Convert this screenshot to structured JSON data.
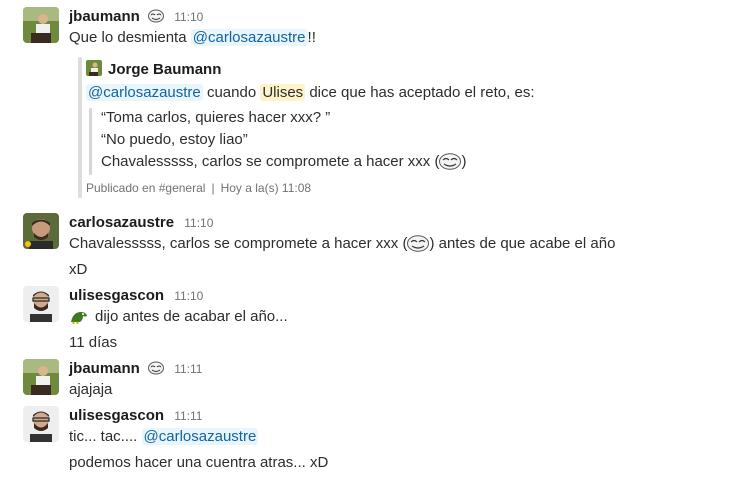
{
  "messages": [
    {
      "user": "jbaumann",
      "time": "11:10",
      "text_before": "Que lo desmienta ",
      "mention": "@carlosazaustre",
      "text_after": "!!"
    },
    {
      "user": "carlosazaustre",
      "time": "11:10",
      "line1": "Chavalesssss, carlos se compromete a hacer xxx (",
      "line1_after": ") antes de que acabe el año",
      "line2": "xD"
    },
    {
      "user": "ulisesgascon",
      "time": "11:10",
      "line1": "dijo antes de acabar el año...",
      "line2": "11 días"
    },
    {
      "user": "jbaumann",
      "time": "11:11",
      "line1": "ajajaja"
    },
    {
      "user": "ulisesgascon",
      "time": "11:11",
      "line1_before": "tic... tac.... ",
      "mention": "@carlosazaustre",
      "line2": "podemos hacer una cuentra atras... xD"
    }
  ],
  "attachment": {
    "author": "Jorge Baumann",
    "mention": "@carlosazaustre",
    "text_mid": " cuando ",
    "highlight": "Ulises",
    "text_end": " dice que has aceptado el reto, es:",
    "quote": [
      "“Toma carlos, quieres hacer xxx? ”",
      "“No puedo, estoy liao”",
      "Chavalesssss, carlos se compromete a hacer xxx ("
    ],
    "quote_end": ")",
    "posted_in": "Publicado en #general",
    "posted_time": "Hoy a la(s) 11:08"
  },
  "colors": {
    "mention": "#1264a3",
    "mention_bg": "#e8f5fa",
    "highlight_bg": "#fef4c7",
    "username": "#1d1c1d",
    "timestamp": "#717274"
  },
  "icons": {
    "status_emoji": "trollface-icon",
    "inline_emoji": "trollface-icon",
    "reaction_emoji": "dinosaur-icon"
  }
}
